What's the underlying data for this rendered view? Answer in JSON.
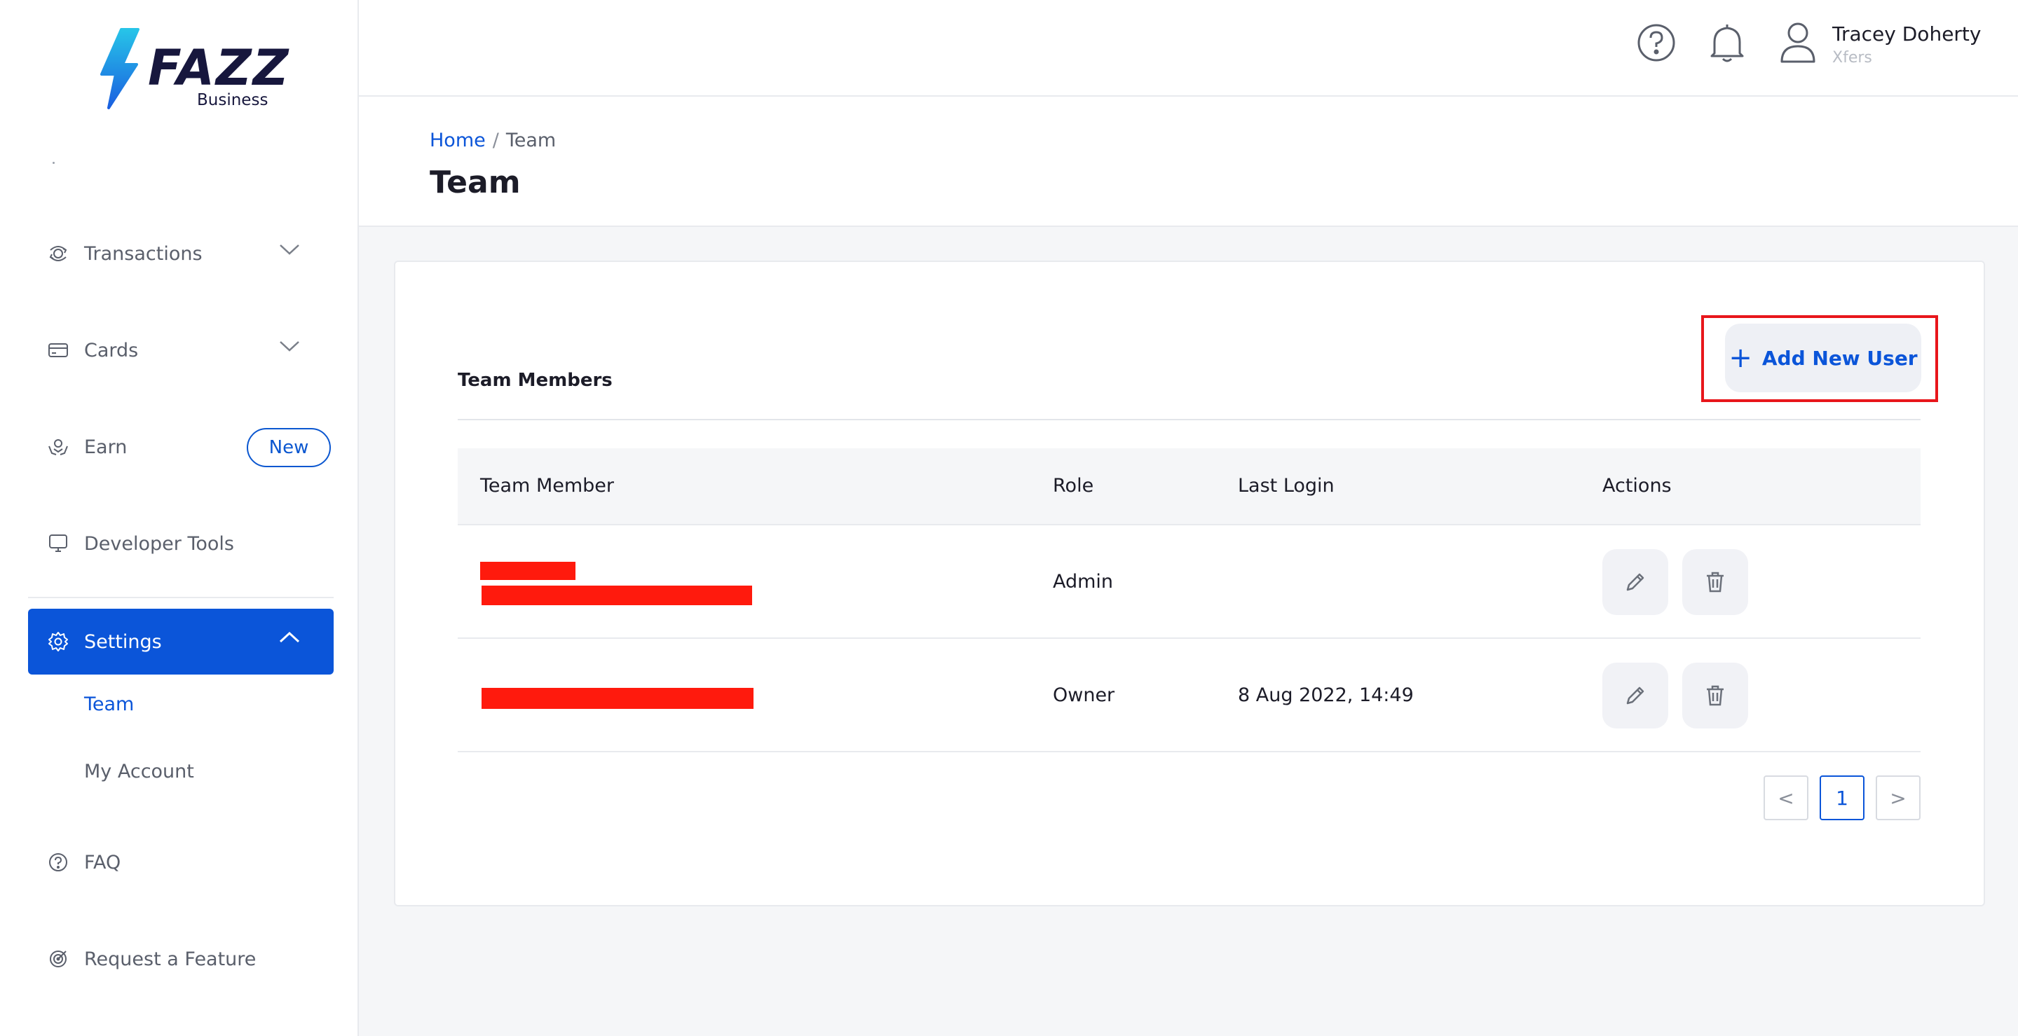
{
  "brand": {
    "name": "FAZZ",
    "subtitle": "Business"
  },
  "sidebar": {
    "items": [
      {
        "label": "Transactions",
        "icon": "transactions-icon",
        "expandable": true
      },
      {
        "label": "Cards",
        "icon": "card-icon",
        "expandable": true
      },
      {
        "label": "Earn",
        "icon": "earn-icon",
        "badge": "New"
      },
      {
        "label": "Developer Tools",
        "icon": "monitor-icon"
      }
    ],
    "active": {
      "label": "Settings",
      "icon": "gear-icon",
      "expanded": true
    },
    "sub_items": [
      {
        "label": "Team",
        "active": true
      },
      {
        "label": "My Account",
        "active": false
      }
    ],
    "bottom_items": [
      {
        "label": "FAQ",
        "icon": "question-icon"
      },
      {
        "label": "Request a Feature",
        "icon": "target-icon"
      }
    ]
  },
  "header": {
    "user_name": "Tracey Doherty",
    "user_org": "Xfers"
  },
  "breadcrumb": {
    "home": "Home",
    "separator": "/",
    "current": "Team"
  },
  "page_title": "Team",
  "section": {
    "title": "Team Members",
    "add_button": "Add New User"
  },
  "table": {
    "columns": [
      "Team Member",
      "Role",
      "Last Login",
      "Actions"
    ],
    "rows": [
      {
        "role": "Admin",
        "last_login": "",
        "member_redacted": true
      },
      {
        "role": "Owner",
        "last_login": "8 Aug 2022, 14:49",
        "member_redacted": true
      }
    ]
  },
  "pagination": {
    "current": "1",
    "prev": "<",
    "next": ">"
  },
  "colors": {
    "primary": "#0b55d9",
    "highlight": "#e8161b",
    "redaction": "#ff1a0d"
  }
}
